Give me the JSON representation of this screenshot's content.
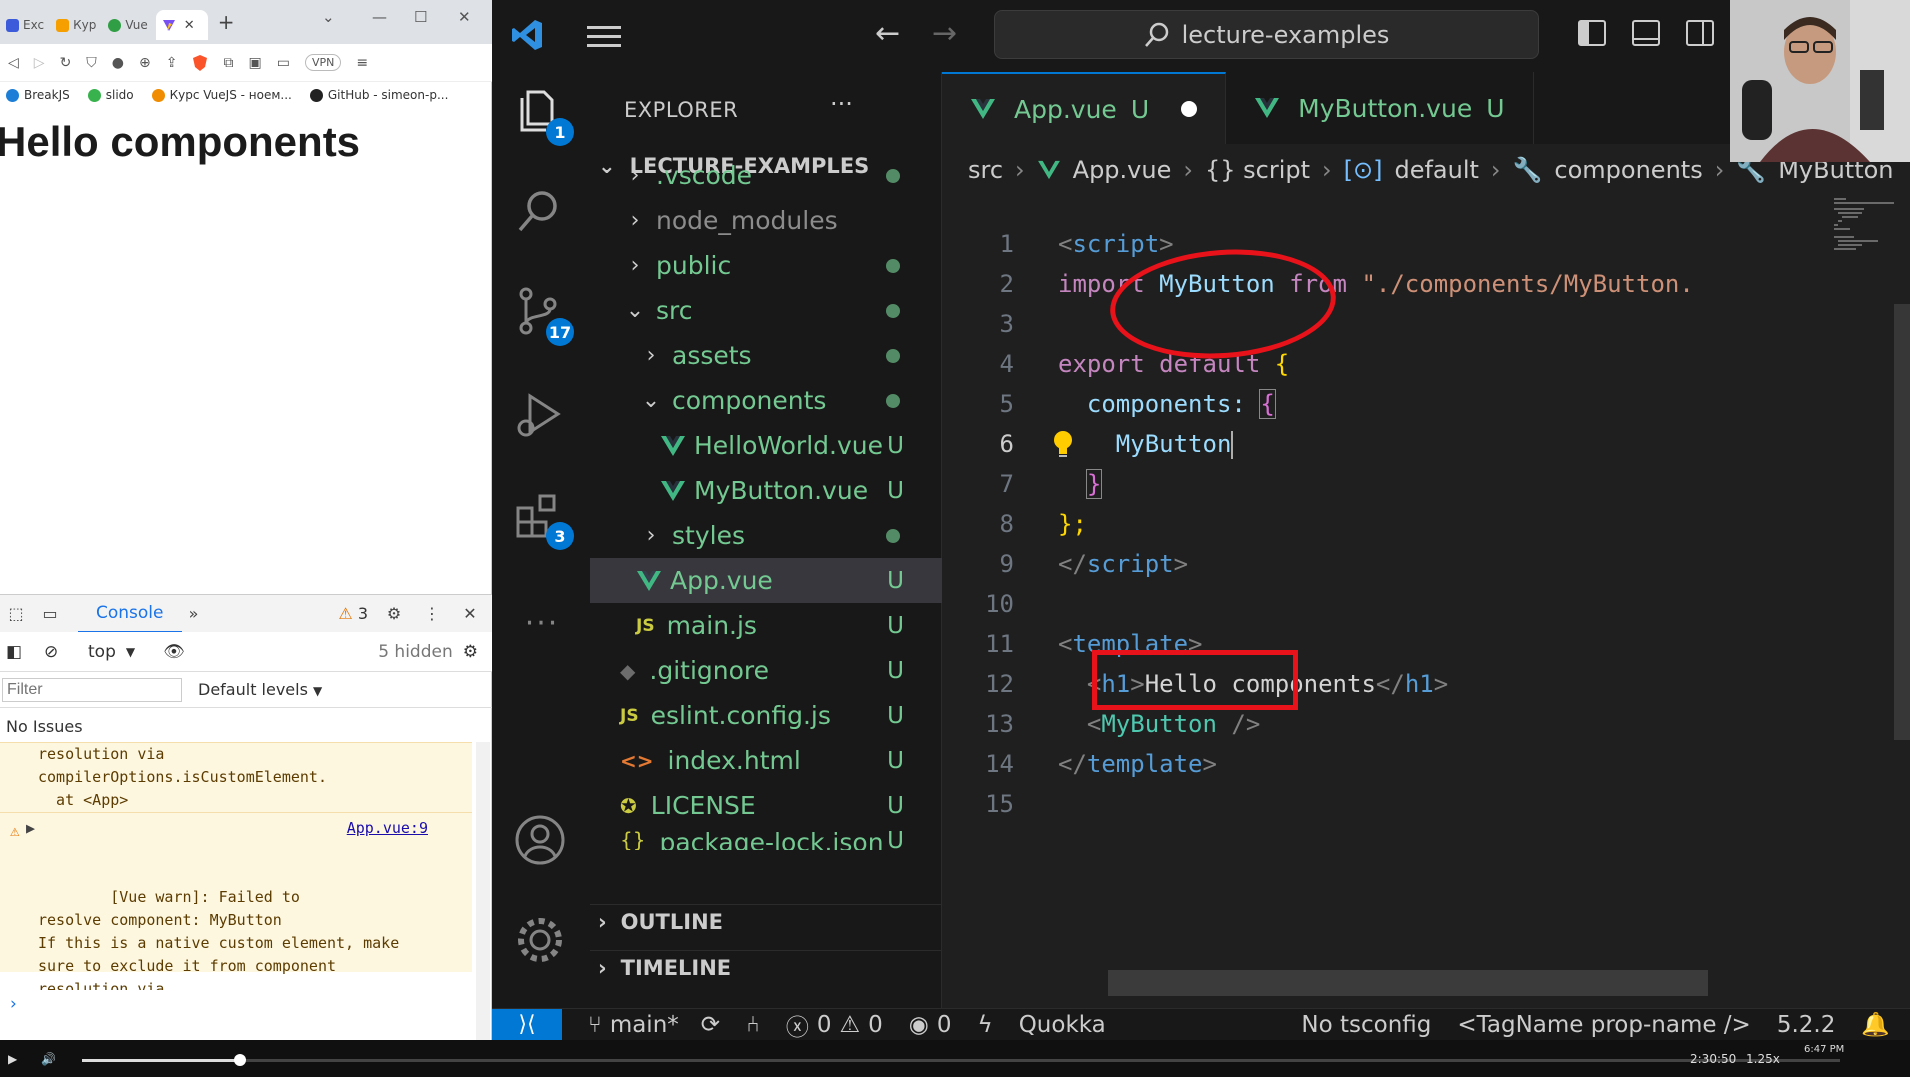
{
  "browser": {
    "tabs": [
      {
        "label": "Exc",
        "color": "#3b5bdb"
      },
      {
        "label": "Кур",
        "color": "#f59f00"
      },
      {
        "label": "Vue",
        "color": "#2f9e44"
      },
      {
        "label": "",
        "color": "#7950f2"
      }
    ],
    "new_tab": "+",
    "vpn_label": "VPN",
    "bookmarks": [
      {
        "label": "BreakJS",
        "color": "#1c7ed6"
      },
      {
        "label": "slido",
        "color": "#37b24d"
      },
      {
        "label": "Курс VueJS - ноем...",
        "color": "#f08c00"
      },
      {
        "label": "GitHub - simeon-p...",
        "color": "#222222"
      }
    ],
    "page_heading": "Hello components"
  },
  "devtools": {
    "console_tab": "Console",
    "more_tabs": "»",
    "warning_count": "3",
    "context": "top",
    "hidden_count": "5 hidden",
    "filter_placeholder": "Filter",
    "levels": "Default levels",
    "no_issues": "No Issues",
    "message_1": "resolution via\ncompilerOptions.isCustomElement.\n  at <App>",
    "message_2": "[Vue warn]: Failed to\nresolve component: MyButton\nIf this is a native custom element, make\nsure to exclude it from component\nresolution via\ncompilerOptions.isCustomElement.\n  at <App>",
    "message_2_link": "App.vue:9",
    "prompt": "›"
  },
  "vscode": {
    "search": "lecture-examples",
    "badges": {
      "explorer": "1",
      "scm": "17",
      "extensions": "3"
    },
    "explorer_title": "EXPLORER",
    "explorer_more": "···",
    "root": "LECTURE-EXAMPLES",
    "tree": [
      {
        "name": ".vscode",
        "chevron": "›",
        "status": "dot"
      },
      {
        "name": "node_modules",
        "chevron": "›",
        "status": ""
      },
      {
        "name": "public",
        "chevron": "›",
        "status": "dot"
      },
      {
        "name": "src",
        "chevron": "⌄",
        "status": "dot"
      },
      {
        "name": "assets",
        "chevron": "›",
        "status": "dot"
      },
      {
        "name": "components",
        "chevron": "⌄",
        "status": "dot"
      },
      {
        "name": "HelloWorld.vue",
        "chevron": "",
        "status": "U"
      },
      {
        "name": "MyButton.vue",
        "chevron": "",
        "status": "U"
      },
      {
        "name": "styles",
        "chevron": "›",
        "status": "dot"
      },
      {
        "name": "App.vue",
        "chevron": "",
        "status": "U"
      },
      {
        "name": "main.js",
        "chevron": "",
        "status": "U"
      },
      {
        "name": ".gitignore",
        "chevron": "",
        "status": "U"
      },
      {
        "name": "eslint.config.js",
        "chevron": "",
        "status": "U"
      },
      {
        "name": "index.html",
        "chevron": "",
        "status": "U"
      },
      {
        "name": "LICENSE",
        "chevron": "",
        "status": "U"
      },
      {
        "name": "package-lock.json",
        "chevron": "",
        "status": "U"
      }
    ],
    "outline": "OUTLINE",
    "timeline": "TIMELINE",
    "tabs": [
      {
        "label": "App.vue",
        "status": "U"
      },
      {
        "label": "MyButton.vue",
        "status": "U"
      }
    ],
    "breadcrumb": [
      "src",
      "App.vue",
      "{} script",
      "default",
      "components",
      "MyButton"
    ],
    "code_lines": [
      "1",
      "2",
      "3",
      "4",
      "5",
      "6",
      "7",
      "8",
      "9",
      "10",
      "11",
      "12",
      "13",
      "14",
      "15"
    ],
    "code": {
      "l1_tag": "<",
      "l1_name": "script",
      "l1_close": ">",
      "l2_kw": "import",
      "l2_id": "MyButton",
      "l2_from": "from",
      "l2_str": "\"./components/MyButton.",
      "l4_export": "export",
      "l4_default": "default",
      "l4_brace": "{",
      "l5_key": "components:",
      "l5_brace": "{",
      "l6_id": "MyButton",
      "l7_brace": "}",
      "l8_brace": "};",
      "l9_tag": "</",
      "l9_name": "script",
      "l9_close": ">",
      "l11_open": "<",
      "l11_name": "template",
      "l11_close": ">",
      "l12_open": "<",
      "l12_tag": "h1",
      "l12_close": ">",
      "l12_text": "Hello components",
      "l12_end_open": "</",
      "l12_end_tag": "h1",
      "l12_end_close": ">",
      "l13_open": "<",
      "l13_comp": "MyButton",
      "l13_close": " />",
      "l14_open": "</",
      "l14_name": "template",
      "l14_close": ">"
    },
    "status": {
      "branch": "main*",
      "errors": "0",
      "warnings": "0",
      "ports": "0",
      "quokka": "Quokka",
      "tsconfig": "No tsconfig",
      "tagname": "<TagName prop-name />",
      "version": "5.2.2"
    }
  },
  "player": {
    "time": "2:30:50",
    "speed": "1.25x",
    "clock": "6:47 PM"
  },
  "colors": {
    "accent": "#0078d4",
    "git_untracked": "#73c991",
    "annotation": "#e8121a"
  }
}
